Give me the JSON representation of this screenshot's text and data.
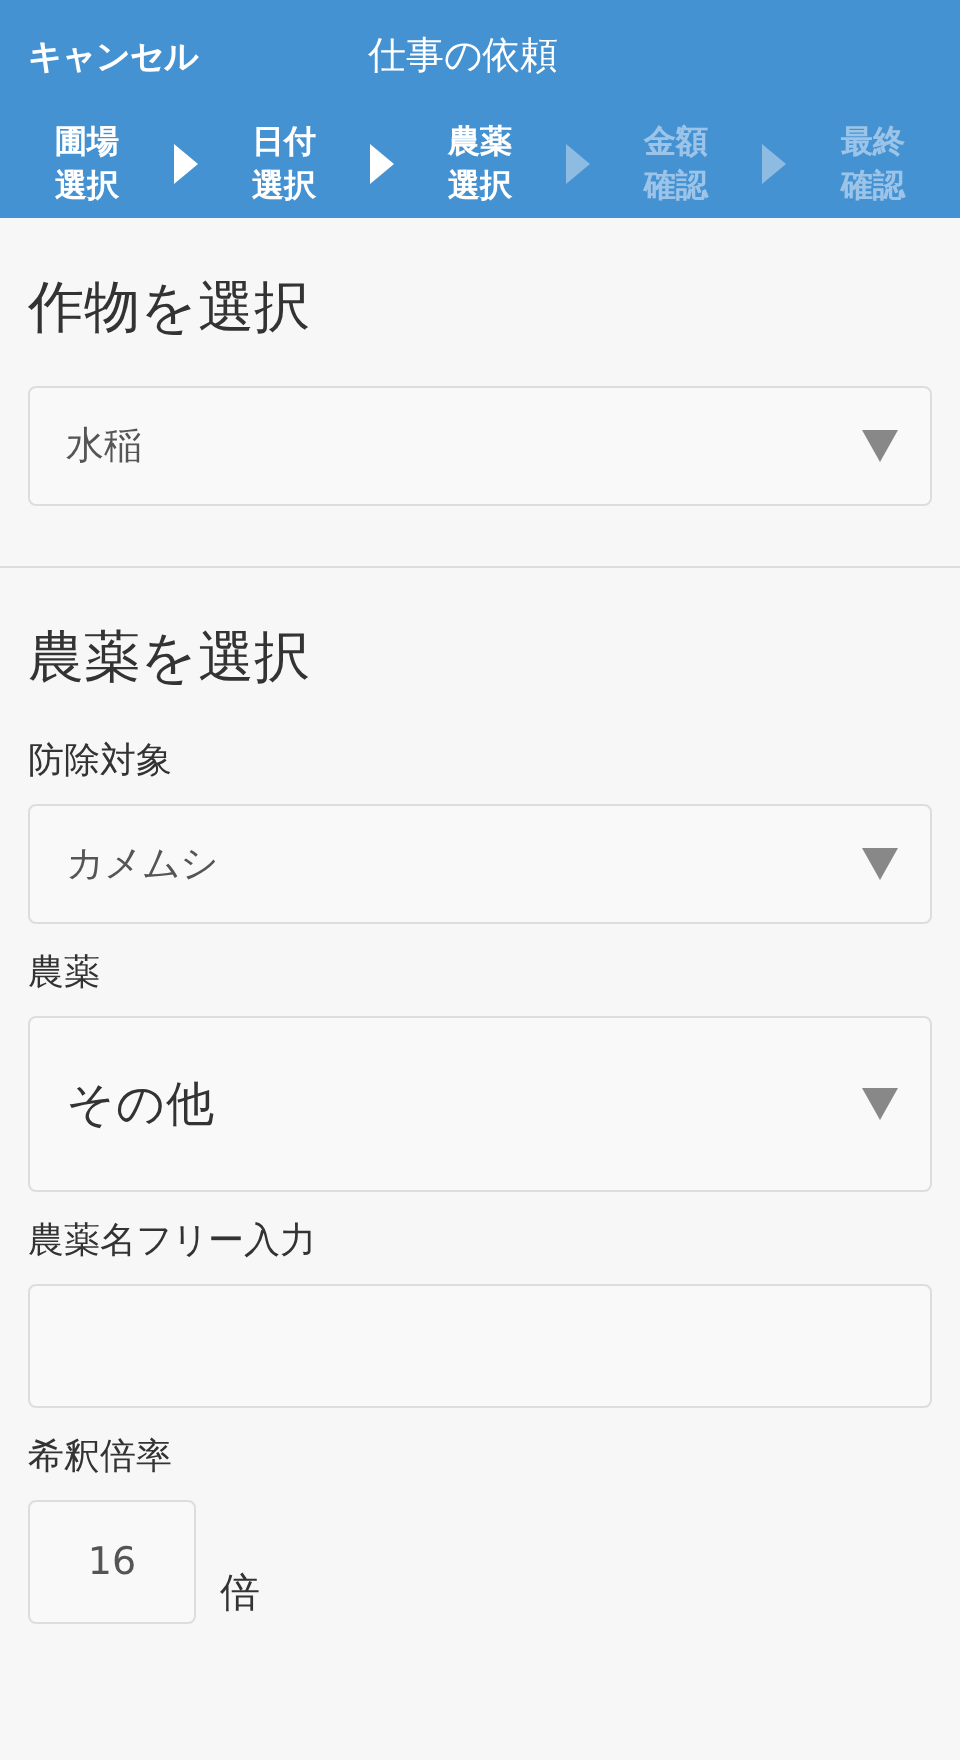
{
  "header": {
    "cancel": "キャンセル",
    "title": "仕事の依頼"
  },
  "steps": [
    {
      "label": "圃場選択",
      "active": true
    },
    {
      "label": "日付選択",
      "active": true
    },
    {
      "label": "農薬選択",
      "active": true
    },
    {
      "label": "金額確認",
      "active": false
    },
    {
      "label": "最終確認",
      "active": false
    }
  ],
  "sections": [
    {
      "heading": "作物を選択",
      "fields": [
        {
          "kind": "select",
          "value": "水稲",
          "large": false
        }
      ]
    },
    {
      "heading": "農薬を選択",
      "fields": [
        {
          "kind": "select",
          "label": "防除対象",
          "value": "カメムシ",
          "large": false
        },
        {
          "kind": "select",
          "label": "農薬",
          "value": "その他",
          "large": true
        },
        {
          "kind": "text",
          "label": "農薬名フリー入力"
        },
        {
          "kind": "number",
          "label": "希釈倍率",
          "value": "16",
          "unit": "倍"
        }
      ]
    }
  ]
}
